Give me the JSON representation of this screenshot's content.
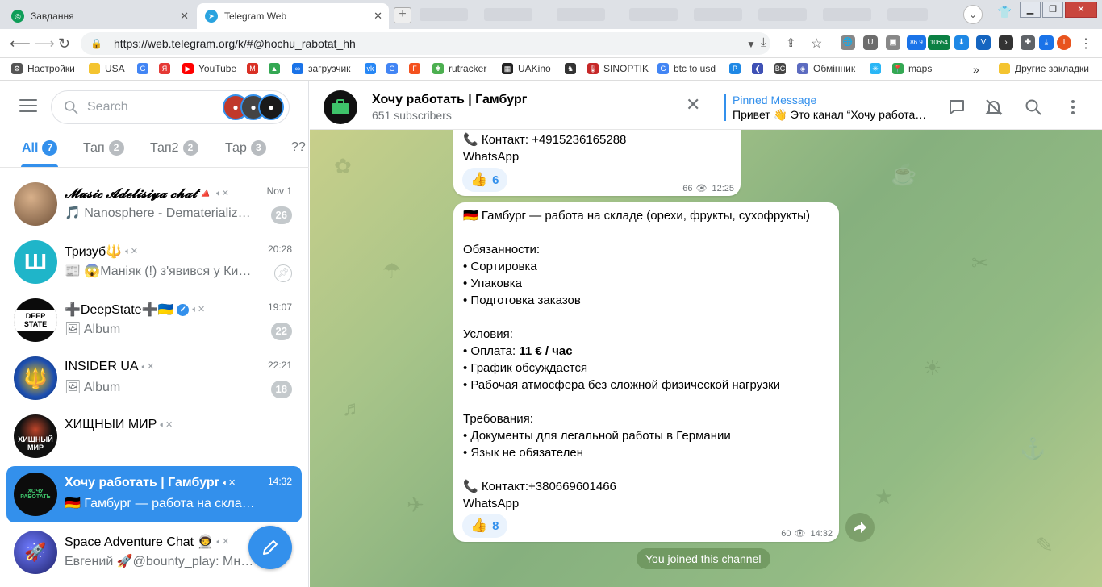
{
  "browser": {
    "tabs": [
      {
        "title": "Завдання"
      },
      {
        "title": "Telegram Web"
      }
    ],
    "profile_initial": "I",
    "url": "https://web.telegram.org/k/#@hochu_rabotat_hh",
    "ext_badges": {
      "weather": "86.9",
      "counter": "10654"
    },
    "bookmarks": [
      {
        "label": "Настройки",
        "color": "#555"
      },
      {
        "label": "USA",
        "color": "#f4c430"
      },
      {
        "label": "",
        "color": "#4285f4"
      },
      {
        "label": "",
        "color": "#e53935"
      },
      {
        "label": "YouTube",
        "color": "#ff0000"
      },
      {
        "label": "",
        "color": "#d93025"
      },
      {
        "label": "",
        "color": "#34a853"
      },
      {
        "label": "загрузчик",
        "color": "#1a73e8"
      },
      {
        "label": "",
        "color": "#2787f5"
      },
      {
        "label": "",
        "color": "#4285f4"
      },
      {
        "label": "",
        "color": "#f4511e"
      },
      {
        "label": "rutracker",
        "color": "#4caf50"
      },
      {
        "label": "UAKino",
        "color": "#222"
      },
      {
        "label": "",
        "color": "#333"
      },
      {
        "label": "SINOPTIK",
        "color": "#c62828"
      },
      {
        "label": "btc to usd",
        "color": "#4285f4"
      },
      {
        "label": "",
        "color": "#1e88e5"
      },
      {
        "label": "",
        "color": "#3f51b5"
      },
      {
        "label": "",
        "color": "#444"
      },
      {
        "label": "Обмінник",
        "color": "#5c6bc0"
      },
      {
        "label": "",
        "color": "#29b6f6"
      },
      {
        "label": "maps",
        "color": "#34a853"
      }
    ],
    "bookmarks_more": "»",
    "other_bookmarks": "Другие закладки"
  },
  "telegram": {
    "search_placeholder": "Search",
    "folders": [
      {
        "label": "All",
        "count": "7",
        "active": true
      },
      {
        "label": "Тап",
        "count": "2",
        "active": false
      },
      {
        "label": "Тап2",
        "count": "2",
        "active": false
      },
      {
        "label": "Тар",
        "count": "3",
        "active": false
      },
      {
        "label": "??",
        "count": "",
        "active": false
      }
    ],
    "chats": [
      {
        "title": "𝓜𝓾𝓼𝓲𝓬 𝓐𝓭𝓮𝓵𝓲𝓼𝓲𝔂𝓪 𝓬𝓱𝓪𝓽🔺",
        "time": "Nov 1",
        "message": "🎵 Nanosphere - Dematerialize (…",
        "badge": "26",
        "avatar_color": "#a0785a",
        "avatar_text": ""
      },
      {
        "title": "Тризуб🔱",
        "time": "20:28",
        "message": "📰 😱Маніяк (!) з'явився у Києві:…",
        "badge": "",
        "pinned": true,
        "avatar_color": "#1fb5c9",
        "avatar_text": "Ш"
      },
      {
        "title": "➕DeepState➕🇺🇦",
        "time": "19:07",
        "message": "🖼 Album",
        "badge": "22",
        "verified": true,
        "avatar_color": "#0b0b0b",
        "avatar_text": "DEEP STATE"
      },
      {
        "title": "INSIDER UA",
        "time": "22:21",
        "message": "🖼 Album",
        "badge": "18",
        "avatar_color": "#1d4fb0",
        "avatar_text": "🔱"
      },
      {
        "title": "ХИЩНЫЙ МИР",
        "time": "",
        "message": "",
        "badge": "",
        "avatar_color": "#111",
        "avatar_text": "ХИЩНЫЙ МИР"
      },
      {
        "title": "Хочу работать | Гамбург",
        "time": "14:32",
        "message": "🇩🇪 Гамбург — работа на складе (оре…",
        "badge": "",
        "active": true,
        "avatar_color": "#0c0c0c",
        "avatar_text": "ХОЧУ РАБОТАТЬ"
      },
      {
        "title": "Space Adventure Chat 👨‍🚀",
        "time": "",
        "message": "Евгений 🚀@bounty_play: Мне н…",
        "badge": "",
        "avatar_color": "#3b3f9e",
        "avatar_text": "🚀"
      }
    ],
    "header": {
      "title": "Хочу работать | Гамбург",
      "subtitle": "651 subscribers",
      "pinned_title": "Pinned Message",
      "pinned_text": "Привет 👋 Это канал “Хочу работа…"
    },
    "messages": [
      {
        "lines": [
          "📞 Контакт: +4915236165288",
          "WhatsApp"
        ],
        "reaction": {
          "emoji": "👍",
          "count": "6"
        },
        "views": "66",
        "time": "12:25"
      },
      {
        "lines": [
          "🇩🇪 Гамбург — работа на складе (орехи, фрукты, сухофрукты)",
          "",
          "Обязанности:",
          "• Сортировка",
          "• Упаковка",
          "• Подготовка заказов",
          "",
          "Условия:",
          "• Оплата: 11 € / час",
          "• График обсуждается",
          "• Рабочая атмосфера без сложной физической нагрузки",
          "",
          "Требования:",
          "• Документы для легальной работы в Германии",
          "• Язык не обязателен",
          "",
          "📞 Контакт:+380669601466",
          "WhatsApp"
        ],
        "reaction": {
          "emoji": "👍",
          "count": "8"
        },
        "views": "60",
        "time": "14:32"
      }
    ],
    "service_message": "You joined this channel",
    "accent": "#3390ec"
  }
}
